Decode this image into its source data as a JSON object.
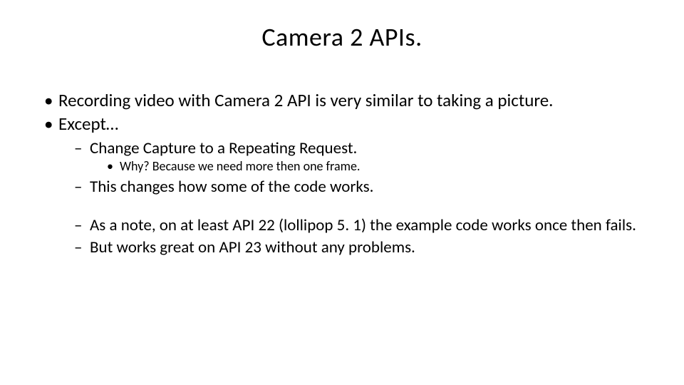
{
  "title": "Camera 2 APIs.",
  "bullets": {
    "b1": "Recording video with Camera 2 API is very similar to taking a picture.",
    "b2": "Except…",
    "s1": "Change Capture to a Repeating Request.",
    "s1a": "Why?  Because we need more then one frame.",
    "s2": "This changes how some of the code works.",
    "s3": "As a note, on at least API 22 (lollipop 5. 1) the example code works once then fails.",
    "s4": "But works great on API 23 without any problems."
  }
}
